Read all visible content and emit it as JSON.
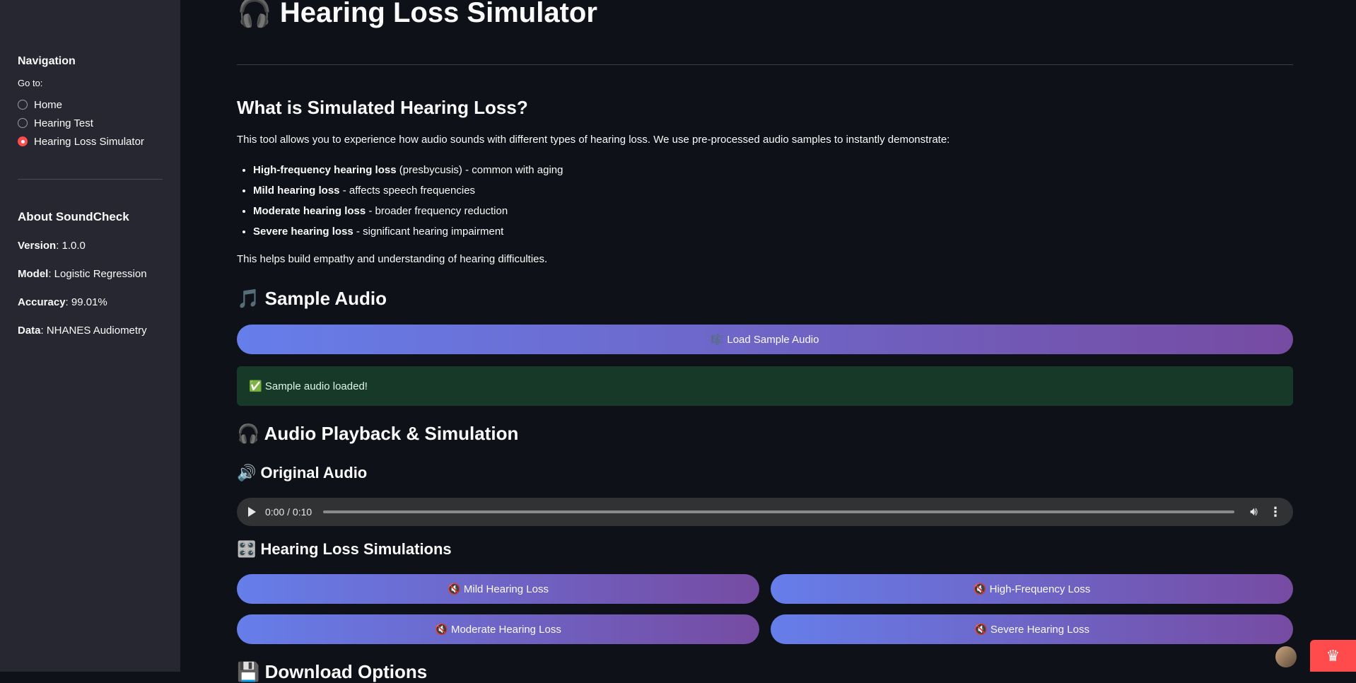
{
  "sidebar": {
    "navigation_heading": "Navigation",
    "goto_label": "Go to:",
    "options": [
      "Home",
      "Hearing Test",
      "Hearing Loss Simulator"
    ],
    "selected_option": "Hearing Loss Simulator",
    "about_heading": "About SoundCheck",
    "about": [
      {
        "label": "Version",
        "value": ": 1.0.0"
      },
      {
        "label": "Model",
        "value": ": Logistic Regression"
      },
      {
        "label": "Accuracy",
        "value": ": 99.01%"
      },
      {
        "label": "Data",
        "value": ": NHANES Audiometry"
      }
    ]
  },
  "main": {
    "title": "🎧 Hearing Loss Simulator",
    "what_heading": "What is Simulated Hearing Loss?",
    "intro": "This tool allows you to experience how audio sounds with different types of hearing loss. We use pre-processed audio samples to instantly demonstrate:",
    "bullets": [
      {
        "bold": "High-frequency hearing loss",
        "rest": " (presbycusis) - common with aging"
      },
      {
        "bold": "Mild hearing loss",
        "rest": " - affects speech frequencies"
      },
      {
        "bold": "Moderate hearing loss",
        "rest": " - broader frequency reduction"
      },
      {
        "bold": "Severe hearing loss",
        "rest": " - significant hearing impairment"
      }
    ],
    "empathy": "This helps build empathy and understanding of hearing difficulties.",
    "sample_heading": "🎵 Sample Audio",
    "load_button": "🎼 Load Sample Audio",
    "success_msg": "✅ Sample audio loaded!",
    "playback_heading": "🎧 Audio Playback & Simulation",
    "original_heading": "🔊 Original Audio",
    "player_time": "0:00 / 0:10",
    "player_progress": 0,
    "simulations_heading": "🎛️ Hearing Loss Simulations",
    "sim_buttons": [
      "🔇 Mild Hearing Loss",
      "🔇 High-Frequency Loss",
      "🔇 Moderate Hearing Loss",
      "🔇 Severe Hearing Loss"
    ],
    "download_heading": "💾 Download Options"
  },
  "colors": {
    "accent": "#ff4b4b",
    "gradient_start": "#667eea",
    "gradient_end": "#764ba2",
    "success_bg": "#173928"
  }
}
